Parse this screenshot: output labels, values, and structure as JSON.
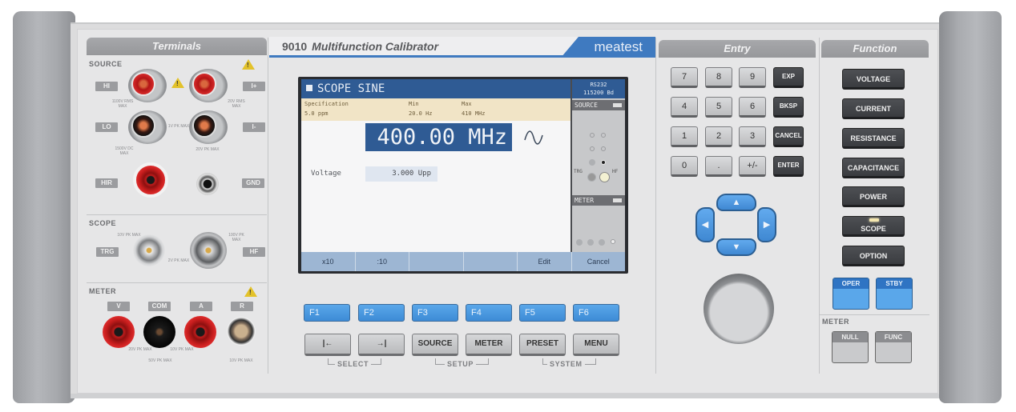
{
  "device": {
    "model": "9010",
    "name": "Multifunction Calibrator",
    "brand": "meatest"
  },
  "terminals": {
    "header": "Terminals",
    "source": {
      "label": "SOURCE",
      "tags": {
        "hi": "HI",
        "lo": "LO",
        "ip": "I+",
        "im": "I-",
        "hir": "HIR",
        "gnd": "GND"
      },
      "ratings": {
        "hi": "1100V RMS MAX",
        "current": "20V RMS MAX",
        "lo_mid": "1V PK MAX",
        "hir": "1500V DC MAX",
        "gnd": "20V PK MAX"
      }
    },
    "scope": {
      "label": "SCOPE",
      "tags": {
        "trg": "TRG",
        "hf": "HF"
      },
      "ratings": {
        "trg": "10V PK MAX",
        "hf": "100V PK MAX",
        "mid": "2V PK MAX"
      }
    },
    "meter": {
      "label": "METER",
      "tags": {
        "v": "V",
        "com": "COM",
        "a": "A",
        "r": "R"
      },
      "ratings": {
        "v": "20V PK MAX",
        "a": "10V PK MAX",
        "com": "50V PK MAX",
        "r": "10V PK MAX"
      }
    }
  },
  "display": {
    "mode_title": "SCOPE SINE",
    "interface": "RS232",
    "baud": "115200 Bd",
    "spec": {
      "specification_label": "Specification",
      "specification_value": "5.0 ppm",
      "min_label": "Min",
      "min_value": "20.0 Hz",
      "max_label": "Max",
      "max_value": "410 MHz"
    },
    "frequency": "400.00 MHz",
    "waveform_icon": "sine-wave",
    "voltage_label": "Voltage",
    "voltage_value": "3.000 Upp",
    "side_source_label": "SOURCE",
    "side_meter_label": "METER",
    "side_trg_label": "TRG",
    "side_hf_label": "HF",
    "softkeys": [
      "x10",
      ":10",
      "",
      "",
      "Edit",
      "Cancel"
    ]
  },
  "fkeys": [
    "F1",
    "F2",
    "F3",
    "F4",
    "F5",
    "F6"
  ],
  "nav_keys": {
    "select_prev": "|←",
    "select_next": "→|",
    "source": "SOURCE",
    "meter": "METER",
    "preset": "PRESET",
    "menu": "MENU",
    "group_select": "SELECT",
    "group_setup": "SETUP",
    "group_system": "SYSTEM"
  },
  "entry": {
    "header": "Entry",
    "keys": [
      "7",
      "8",
      "9",
      "4",
      "5",
      "6",
      "1",
      "2",
      "3",
      "0",
      ".",
      "+/-"
    ],
    "side_keys": [
      "EXP",
      "BKSP",
      "CANCEL",
      "ENTER"
    ],
    "arrows": {
      "up": "▲",
      "down": "▼",
      "left": "◀",
      "right": "▶"
    }
  },
  "function": {
    "header": "Function",
    "keys": [
      "VOLTAGE",
      "CURRENT",
      "RESISTANCE",
      "CAPACITANCE",
      "POWER",
      "SCOPE",
      "OPTION"
    ],
    "active_key": "SCOPE",
    "oper": "OPER",
    "stby": "STBY",
    "meter_label": "METER",
    "null": "NULL",
    "func": "FUNC"
  },
  "colors": {
    "lcd_header": "#2f5b94",
    "softkey_bar": "#9db6d3",
    "fkey_blue": "#4a98e0",
    "brand_blue": "#3f7ac0",
    "spec_bg": "#f1e4c6"
  }
}
